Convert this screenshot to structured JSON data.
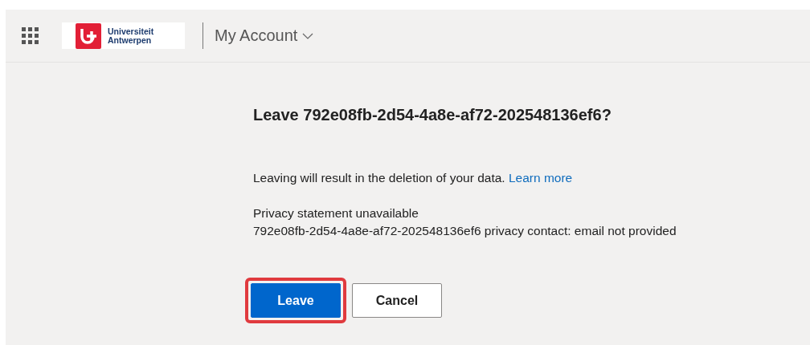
{
  "header": {
    "logo_text": [
      "Universiteit",
      "Antwerpen"
    ],
    "title": "My Account"
  },
  "dialog": {
    "title": "Leave 792e08fb-2d54-4a8e-af72-202548136ef6?",
    "message": "Leaving will result in the deletion of your data.",
    "link": "Learn more",
    "privacy": [
      "Privacy statement unavailable",
      "792e08fb-2d54-4a8e-af72-202548136ef6 privacy contact: email not provided"
    ],
    "buttons": [
      {
        "label": "Leave",
        "kind": "primary",
        "highlighted": true
      },
      {
        "label": "Cancel",
        "kind": "secondary",
        "highlighted": false
      }
    ]
  }
}
